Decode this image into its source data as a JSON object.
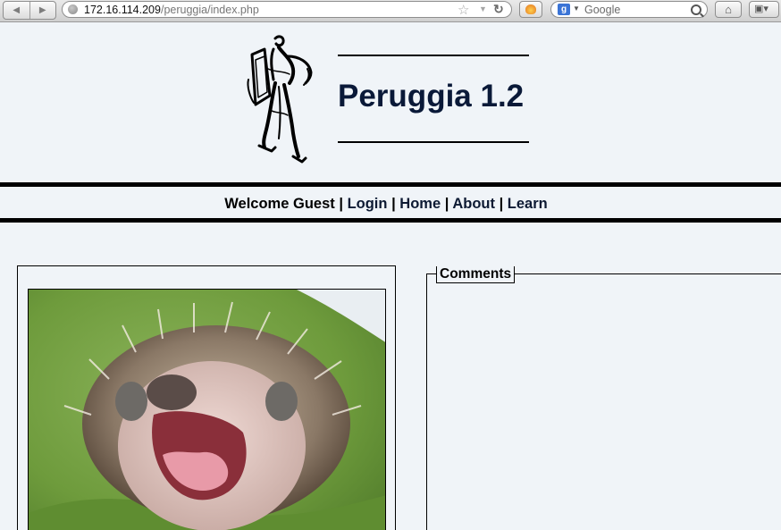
{
  "browser": {
    "url_host": "172.16.114.209",
    "url_path": "/peruggia/index.php",
    "search_placeholder": "Google",
    "search_engine_badge": "g",
    "icons": [
      "back-icon",
      "forward-icon",
      "globe-icon",
      "bookmark-star-icon",
      "dropdown-icon",
      "reload-icon",
      "extension-icon",
      "search-engine-icon",
      "search-icon",
      "home-icon",
      "bookmarks-icon"
    ]
  },
  "site": {
    "title": "Peruggia 1.2"
  },
  "menu": {
    "welcome": "Welcome Guest",
    "separator": "|",
    "items": [
      "Login",
      "Home",
      "About",
      "Learn"
    ]
  },
  "comments": {
    "heading": "Comments"
  }
}
